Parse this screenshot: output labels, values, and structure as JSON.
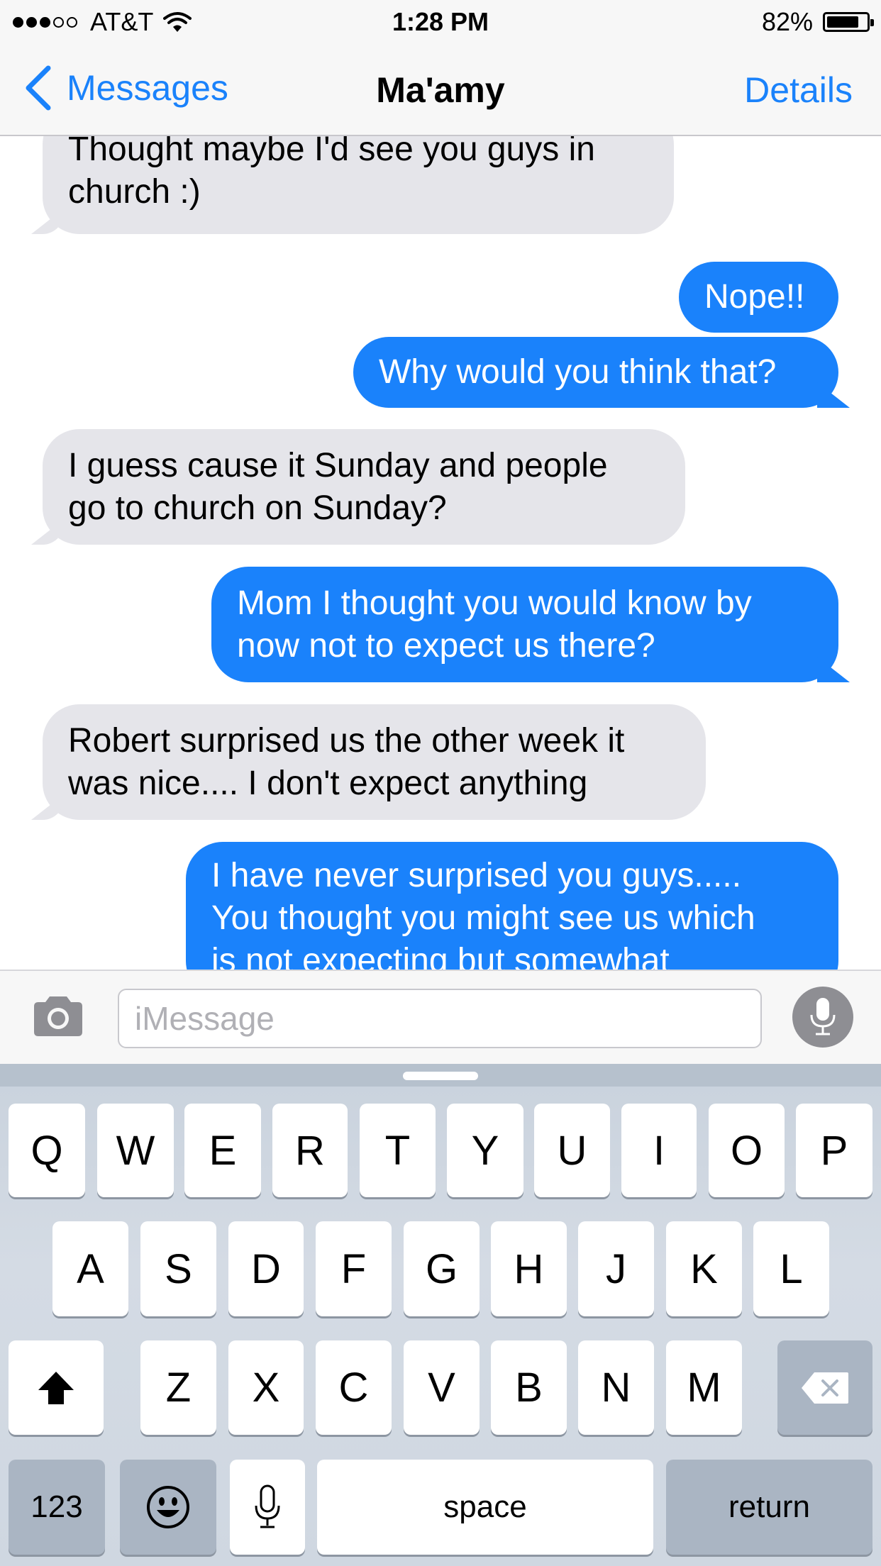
{
  "status_bar": {
    "carrier": "AT&T",
    "signal_bars_filled": 3,
    "signal_bars_total": 5,
    "time": "1:28 PM",
    "battery_text": "82%",
    "battery_level": 0.82
  },
  "nav": {
    "back_label": "Messages",
    "title": "Ma'amy",
    "details_label": "Details"
  },
  "messages": [
    {
      "from": "them",
      "lines": [
        "Thought maybe I'd see you guys in",
        "church :)"
      ]
    },
    {
      "from": "me",
      "lines": [
        "Nope!!"
      ]
    },
    {
      "from": "me",
      "lines": [
        "Why would you think that?"
      ]
    },
    {
      "from": "them",
      "lines": [
        "I guess cause it Sunday and people",
        "go to church on Sunday?"
      ]
    },
    {
      "from": "me",
      "lines": [
        "Mom I thought you would know by",
        "now not to expect us there?"
      ]
    },
    {
      "from": "them",
      "lines": [
        "Robert surprised us the other week it",
        "was nice.... I don't expect anything"
      ]
    },
    {
      "from": "me",
      "lines": [
        "I have never surprised you guys.....",
        "You thought you might see us which",
        "is not expecting but somewhat"
      ]
    }
  ],
  "input": {
    "placeholder": "iMessage"
  },
  "keyboard": {
    "row1": [
      "Q",
      "W",
      "E",
      "R",
      "T",
      "Y",
      "U",
      "I",
      "O",
      "P"
    ],
    "row2": [
      "A",
      "S",
      "D",
      "F",
      "G",
      "H",
      "J",
      "K",
      "L"
    ],
    "row3": [
      "Z",
      "X",
      "C",
      "V",
      "B",
      "N",
      "M"
    ],
    "numbers_label": "123",
    "space_label": "space",
    "return_label": "return"
  },
  "colors": {
    "accent": "#1a82fb",
    "incoming_bubble": "#e5e5ea",
    "outgoing_bubble": "#1a82fb"
  },
  "icons": {
    "wifi": "wifi-icon",
    "battery": "battery-icon",
    "back": "chevron-left-icon",
    "camera": "camera-icon",
    "mic": "microphone-icon",
    "shift": "shift-icon",
    "delete": "backspace-icon",
    "emoji": "emoji-icon"
  }
}
